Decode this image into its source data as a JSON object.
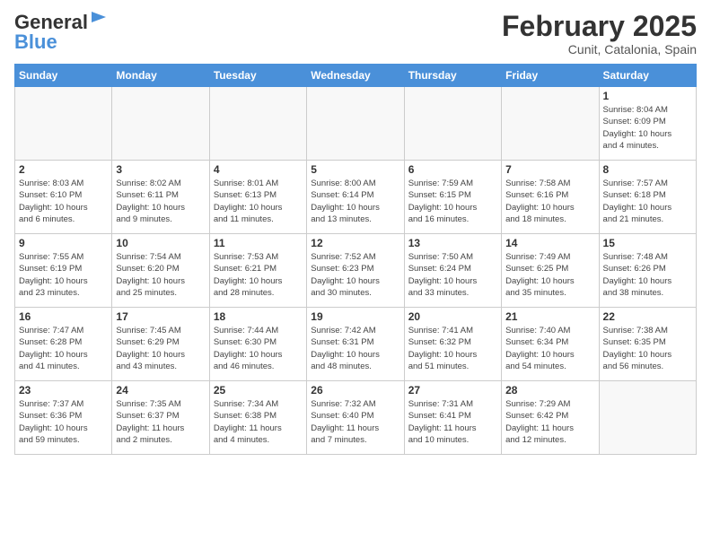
{
  "header": {
    "logo_line1": "General",
    "logo_line2": "Blue",
    "month_title": "February 2025",
    "location": "Cunit, Catalonia, Spain"
  },
  "weekdays": [
    "Sunday",
    "Monday",
    "Tuesday",
    "Wednesday",
    "Thursday",
    "Friday",
    "Saturday"
  ],
  "weeks": [
    [
      {
        "day": "",
        "info": ""
      },
      {
        "day": "",
        "info": ""
      },
      {
        "day": "",
        "info": ""
      },
      {
        "day": "",
        "info": ""
      },
      {
        "day": "",
        "info": ""
      },
      {
        "day": "",
        "info": ""
      },
      {
        "day": "1",
        "info": "Sunrise: 8:04 AM\nSunset: 6:09 PM\nDaylight: 10 hours\nand 4 minutes."
      }
    ],
    [
      {
        "day": "2",
        "info": "Sunrise: 8:03 AM\nSunset: 6:10 PM\nDaylight: 10 hours\nand 6 minutes."
      },
      {
        "day": "3",
        "info": "Sunrise: 8:02 AM\nSunset: 6:11 PM\nDaylight: 10 hours\nand 9 minutes."
      },
      {
        "day": "4",
        "info": "Sunrise: 8:01 AM\nSunset: 6:13 PM\nDaylight: 10 hours\nand 11 minutes."
      },
      {
        "day": "5",
        "info": "Sunrise: 8:00 AM\nSunset: 6:14 PM\nDaylight: 10 hours\nand 13 minutes."
      },
      {
        "day": "6",
        "info": "Sunrise: 7:59 AM\nSunset: 6:15 PM\nDaylight: 10 hours\nand 16 minutes."
      },
      {
        "day": "7",
        "info": "Sunrise: 7:58 AM\nSunset: 6:16 PM\nDaylight: 10 hours\nand 18 minutes."
      },
      {
        "day": "8",
        "info": "Sunrise: 7:57 AM\nSunset: 6:18 PM\nDaylight: 10 hours\nand 21 minutes."
      }
    ],
    [
      {
        "day": "9",
        "info": "Sunrise: 7:55 AM\nSunset: 6:19 PM\nDaylight: 10 hours\nand 23 minutes."
      },
      {
        "day": "10",
        "info": "Sunrise: 7:54 AM\nSunset: 6:20 PM\nDaylight: 10 hours\nand 25 minutes."
      },
      {
        "day": "11",
        "info": "Sunrise: 7:53 AM\nSunset: 6:21 PM\nDaylight: 10 hours\nand 28 minutes."
      },
      {
        "day": "12",
        "info": "Sunrise: 7:52 AM\nSunset: 6:23 PM\nDaylight: 10 hours\nand 30 minutes."
      },
      {
        "day": "13",
        "info": "Sunrise: 7:50 AM\nSunset: 6:24 PM\nDaylight: 10 hours\nand 33 minutes."
      },
      {
        "day": "14",
        "info": "Sunrise: 7:49 AM\nSunset: 6:25 PM\nDaylight: 10 hours\nand 35 minutes."
      },
      {
        "day": "15",
        "info": "Sunrise: 7:48 AM\nSunset: 6:26 PM\nDaylight: 10 hours\nand 38 minutes."
      }
    ],
    [
      {
        "day": "16",
        "info": "Sunrise: 7:47 AM\nSunset: 6:28 PM\nDaylight: 10 hours\nand 41 minutes."
      },
      {
        "day": "17",
        "info": "Sunrise: 7:45 AM\nSunset: 6:29 PM\nDaylight: 10 hours\nand 43 minutes."
      },
      {
        "day": "18",
        "info": "Sunrise: 7:44 AM\nSunset: 6:30 PM\nDaylight: 10 hours\nand 46 minutes."
      },
      {
        "day": "19",
        "info": "Sunrise: 7:42 AM\nSunset: 6:31 PM\nDaylight: 10 hours\nand 48 minutes."
      },
      {
        "day": "20",
        "info": "Sunrise: 7:41 AM\nSunset: 6:32 PM\nDaylight: 10 hours\nand 51 minutes."
      },
      {
        "day": "21",
        "info": "Sunrise: 7:40 AM\nSunset: 6:34 PM\nDaylight: 10 hours\nand 54 minutes."
      },
      {
        "day": "22",
        "info": "Sunrise: 7:38 AM\nSunset: 6:35 PM\nDaylight: 10 hours\nand 56 minutes."
      }
    ],
    [
      {
        "day": "23",
        "info": "Sunrise: 7:37 AM\nSunset: 6:36 PM\nDaylight: 10 hours\nand 59 minutes."
      },
      {
        "day": "24",
        "info": "Sunrise: 7:35 AM\nSunset: 6:37 PM\nDaylight: 11 hours\nand 2 minutes."
      },
      {
        "day": "25",
        "info": "Sunrise: 7:34 AM\nSunset: 6:38 PM\nDaylight: 11 hours\nand 4 minutes."
      },
      {
        "day": "26",
        "info": "Sunrise: 7:32 AM\nSunset: 6:40 PM\nDaylight: 11 hours\nand 7 minutes."
      },
      {
        "day": "27",
        "info": "Sunrise: 7:31 AM\nSunset: 6:41 PM\nDaylight: 11 hours\nand 10 minutes."
      },
      {
        "day": "28",
        "info": "Sunrise: 7:29 AM\nSunset: 6:42 PM\nDaylight: 11 hours\nand 12 minutes."
      },
      {
        "day": "",
        "info": ""
      }
    ]
  ]
}
